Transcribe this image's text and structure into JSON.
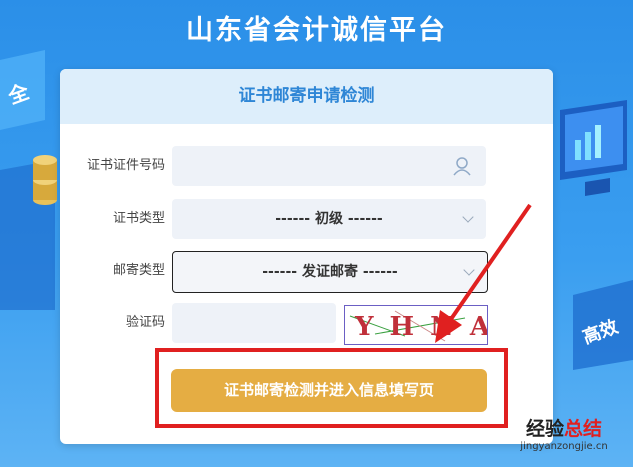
{
  "header": {
    "title": "山东省会计诚信平台"
  },
  "background": {
    "left_text": "全",
    "right_text": "高效"
  },
  "card": {
    "title": "证书邮寄申请检测",
    "fields": [
      {
        "label": "证书证件号码",
        "value": "",
        "icon": "user-icon"
      },
      {
        "label": "证书类型",
        "value": "------ 初级 ------",
        "icon": "chevron-down-icon"
      },
      {
        "label": "邮寄类型",
        "value": "------ 发证邮寄 ------",
        "icon": "chevron-down-icon"
      },
      {
        "label": "验证码",
        "value": "",
        "captcha": "YHNA"
      }
    ],
    "submit_label": "证书邮寄检测并进入信息填写页"
  },
  "annotation": {
    "color": "#e02020"
  },
  "watermark": {
    "line1_black": "经验",
    "line1_red": "总结",
    "line2": "jingyanzongjie.cn"
  },
  "colors": {
    "button": "#e5ad43",
    "header_text": "#2e86d6",
    "background": "#2b8fe8"
  }
}
